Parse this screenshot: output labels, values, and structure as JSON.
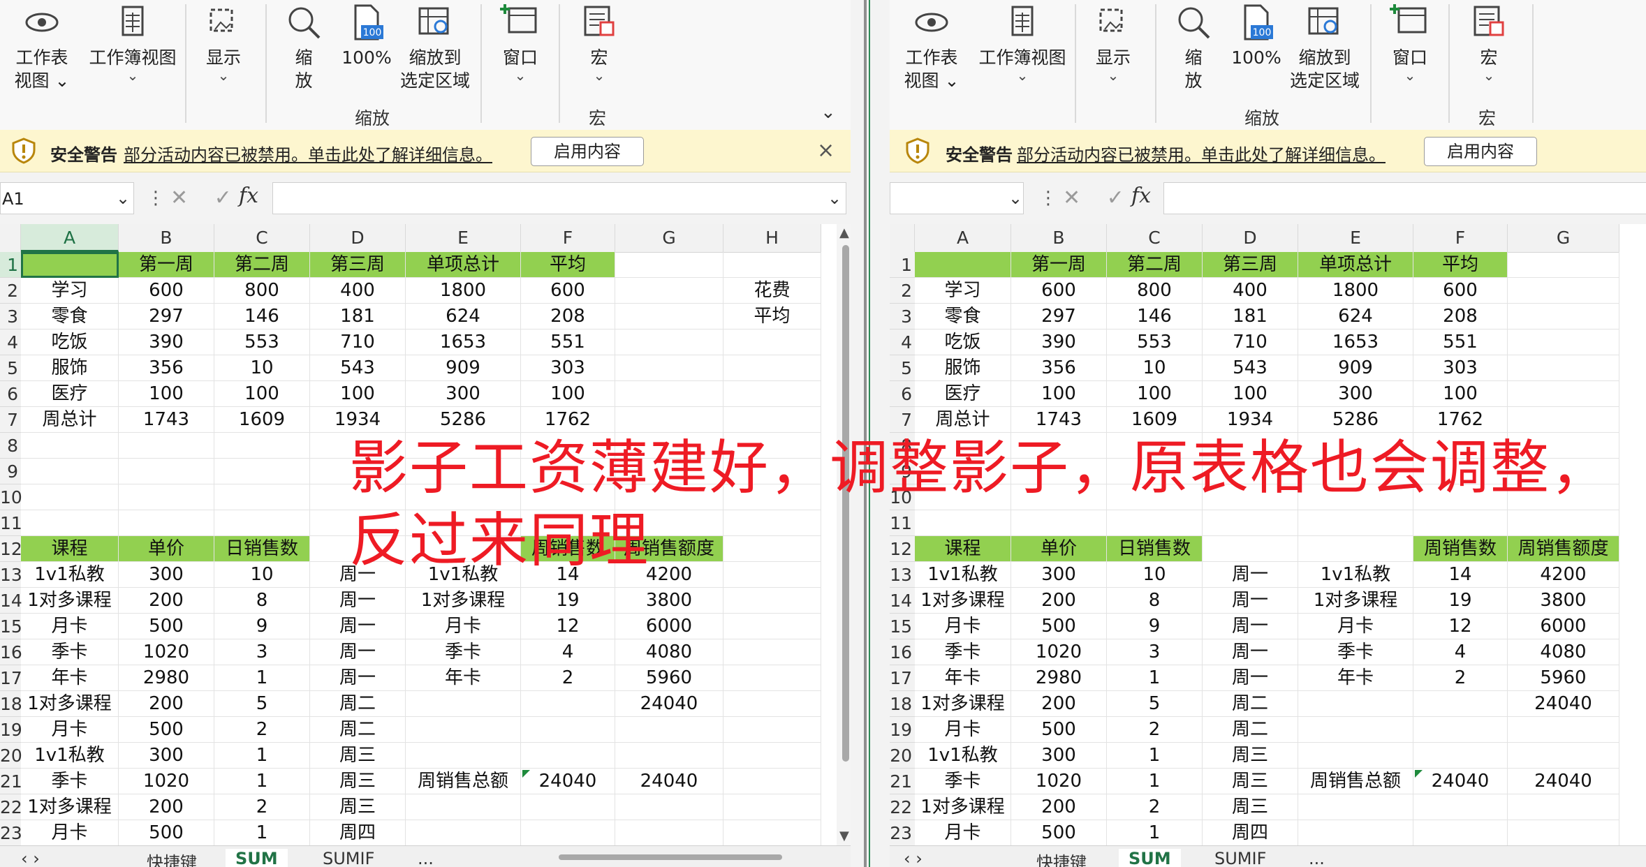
{
  "ribbon": {
    "buttons": [
      {
        "label": "工作表\n视图 ⌄",
        "icon": "eye-icon"
      },
      {
        "label": "工作簿视图",
        "icon": "workbook-view-icon"
      },
      {
        "label": "显示",
        "icon": "show-icon"
      },
      {
        "label": "缩\n放",
        "icon": "zoom-icon"
      },
      {
        "label": "100%",
        "icon": "zoom-100-icon"
      },
      {
        "label": "缩放到\n选定区域",
        "icon": "zoom-to-selection-icon"
      },
      {
        "label": "窗口",
        "icon": "window-icon"
      },
      {
        "label": "宏",
        "icon": "macro-icon"
      }
    ],
    "group_zoom": "缩放",
    "group_macro": "宏",
    "hundred_badge": "100"
  },
  "security": {
    "title": "安全警告",
    "message": "部分活动内容已被禁用。单击此处了解详细信息。",
    "button": "启用内容",
    "close": "×"
  },
  "formula_bar": {
    "left_name": "A1",
    "right_name": "",
    "fx": "fx",
    "cancel_enter": "✕ ✓"
  },
  "grid": {
    "left_columns": [
      "A",
      "B",
      "C",
      "D",
      "E",
      "F",
      "G",
      "H"
    ],
    "right_columns": [
      "A",
      "B",
      "C",
      "D",
      "E",
      "F",
      "G"
    ],
    "row_numbers": [
      "1",
      "2",
      "3",
      "4",
      "5",
      "6",
      "7",
      "8",
      "9",
      "10",
      "11",
      "12",
      "13",
      "14",
      "15",
      "16",
      "17",
      "18",
      "19",
      "20",
      "21",
      "22",
      "23"
    ],
    "rows": [
      [
        "",
        "第一周",
        "第二周",
        "第三周",
        "单项总计",
        "平均",
        "",
        ""
      ],
      [
        "学习",
        "600",
        "800",
        "400",
        "1800",
        "600",
        "",
        "花费"
      ],
      [
        "零食",
        "297",
        "146",
        "181",
        "624",
        "208",
        "",
        "平均"
      ],
      [
        "吃饭",
        "390",
        "553",
        "710",
        "1653",
        "551",
        "",
        ""
      ],
      [
        "服饰",
        "356",
        "10",
        "543",
        "909",
        "303",
        "",
        ""
      ],
      [
        "医疗",
        "100",
        "100",
        "100",
        "300",
        "100",
        "",
        ""
      ],
      [
        "周总计",
        "1743",
        "1609",
        "1934",
        "5286",
        "1762",
        "",
        ""
      ],
      [
        "",
        "",
        "",
        "",
        "",
        "",
        "",
        ""
      ],
      [
        "",
        "",
        "",
        "",
        "",
        "",
        "",
        ""
      ],
      [
        "",
        "",
        "",
        "",
        "",
        "",
        "",
        ""
      ],
      [
        "",
        "",
        "",
        "",
        "",
        "",
        "",
        ""
      ],
      [
        "课程",
        "单价",
        "日销售数",
        "",
        "",
        "周销售数",
        "周销售额度",
        ""
      ],
      [
        "1v1私教",
        "300",
        "10",
        "周一",
        "1v1私教",
        "14",
        "4200",
        ""
      ],
      [
        "1对多课程",
        "200",
        "8",
        "周一",
        "1对多课程",
        "19",
        "3800",
        ""
      ],
      [
        "月卡",
        "500",
        "9",
        "周一",
        "月卡",
        "12",
        "6000",
        ""
      ],
      [
        "季卡",
        "1020",
        "3",
        "周一",
        "季卡",
        "4",
        "4080",
        ""
      ],
      [
        "年卡",
        "2980",
        "1",
        "周一",
        "年卡",
        "2",
        "5960",
        ""
      ],
      [
        "1对多课程",
        "200",
        "5",
        "周二",
        "",
        "",
        "24040",
        ""
      ],
      [
        "月卡",
        "500",
        "2",
        "周二",
        "",
        "",
        "",
        ""
      ],
      [
        "1v1私教",
        "300",
        "1",
        "周三",
        "",
        "",
        "",
        ""
      ],
      [
        "季卡",
        "1020",
        "1",
        "周三",
        "周销售总额",
        "24040",
        "24040",
        ""
      ],
      [
        "1对多课程",
        "200",
        "2",
        "周三",
        "",
        "",
        "",
        ""
      ],
      [
        "月卡",
        "500",
        "1",
        "周四",
        "",
        "",
        "",
        ""
      ]
    ]
  },
  "sheet_tabs": {
    "nav": "‹  ›",
    "tabs": [
      "快捷键",
      "SUM",
      "SUMIF",
      "..."
    ],
    "active": "SUM"
  },
  "overlay_text": "影子工资薄建好，调整影子，原表格也会调整，反过来同理",
  "colors": {
    "header_green": "#92d050",
    "accent": "#217346",
    "warning_bg": "#fdf6cf",
    "annotation_red": "#ee1b24"
  }
}
